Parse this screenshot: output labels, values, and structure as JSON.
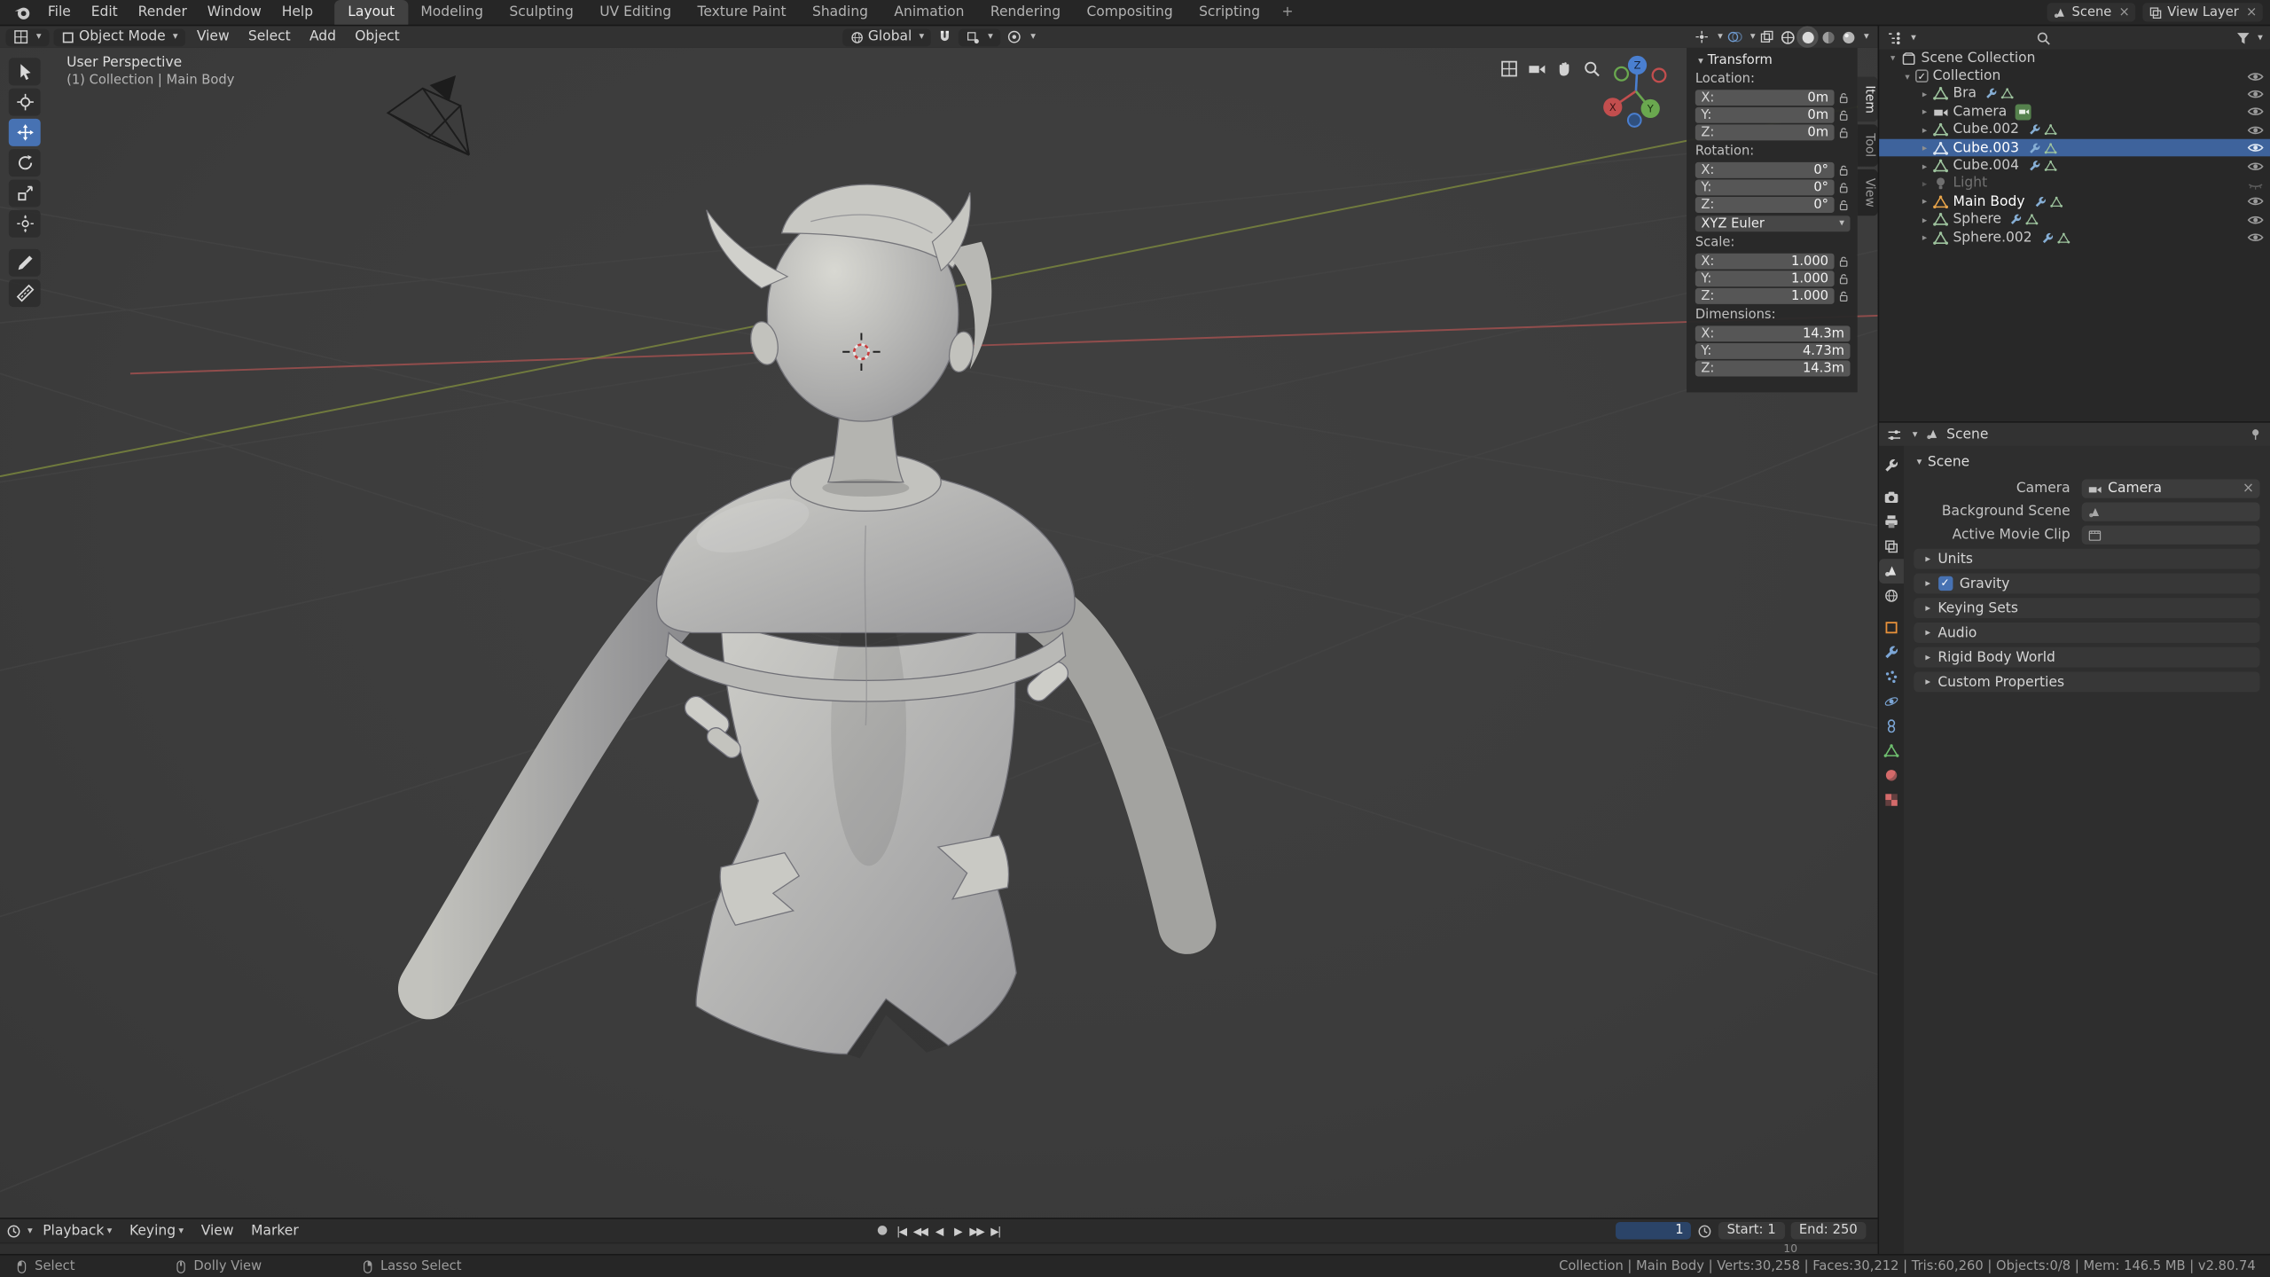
{
  "colors": {
    "accent": "#4772b3",
    "selection_row": "#3e639c",
    "active_object_icon": "#e8a44a",
    "axis_x": "#a0504f",
    "axis_y": "#7d8a3e",
    "gizmo_z": "#4a7fd0",
    "viewport_background": "#3d3d3d"
  },
  "icons": {
    "chevron": "▾",
    "expand": "▸",
    "close": "×",
    "check": "✓",
    "record": "●",
    "jump_start": "|◀",
    "prev_key": "◀◀",
    "play_rev": "◀",
    "play": "▶",
    "next_key": "▶▶",
    "jump_end": "▶|"
  },
  "topbar": {
    "menus": [
      {
        "label": "File"
      },
      {
        "label": "Edit"
      },
      {
        "label": "Render"
      },
      {
        "label": "Window"
      },
      {
        "label": "Help"
      }
    ],
    "workspaces": [
      {
        "label": "Layout",
        "active": true
      },
      {
        "label": "Modeling"
      },
      {
        "label": "Sculpting"
      },
      {
        "label": "UV Editing"
      },
      {
        "label": "Texture Paint"
      },
      {
        "label": "Shading"
      },
      {
        "label": "Animation"
      },
      {
        "label": "Rendering"
      },
      {
        "label": "Compositing"
      },
      {
        "label": "Scripting"
      }
    ],
    "new_workspace": "+",
    "scene_selector": "Scene",
    "view_layer_selector": "View Layer"
  },
  "viewport": {
    "mode": "Object Mode",
    "menus": [
      {
        "label": "View"
      },
      {
        "label": "Select"
      },
      {
        "label": "Add"
      },
      {
        "label": "Object"
      }
    ],
    "orientation": "Global",
    "view_label": "User Perspective",
    "context_label": "(1) Collection | Main Body",
    "gizmo": {
      "x": "X",
      "y": "Y",
      "z": "Z"
    }
  },
  "npanel": {
    "tabs": [
      {
        "label": "Item",
        "active": true
      },
      {
        "label": "Tool"
      },
      {
        "label": "View"
      }
    ],
    "transform": {
      "title": "Transform",
      "location_label": "Location:",
      "rotation_label": "Rotation:",
      "scale_label": "Scale:",
      "dimensions_label": "Dimensions:",
      "rotation_mode": "XYZ Euler",
      "rows": {
        "loc_x": {
          "label": "X:",
          "value": "0m"
        },
        "loc_y": {
          "label": "Y:",
          "value": "0m"
        },
        "loc_z": {
          "label": "Z:",
          "value": "0m"
        },
        "rot_x": {
          "label": "X:",
          "value": "0°"
        },
        "rot_y": {
          "label": "Y:",
          "value": "0°"
        },
        "rot_z": {
          "label": "Z:",
          "value": "0°"
        },
        "scale_x": {
          "label": "X:",
          "value": "1.000"
        },
        "scale_y": {
          "label": "Y:",
          "value": "1.000"
        },
        "scale_z": {
          "label": "Z:",
          "value": "1.000"
        },
        "dim_x": {
          "label": "X:",
          "value": "14.3m"
        },
        "dim_y": {
          "label": "Y:",
          "value": "4.73m"
        },
        "dim_z": {
          "label": "Z:",
          "value": "14.3m"
        }
      }
    }
  },
  "outliner": {
    "scene_collection": "Scene Collection",
    "collection": "Collection",
    "items": [
      {
        "name": "Bra",
        "type": "mesh"
      },
      {
        "name": "Camera",
        "type": "camera"
      },
      {
        "name": "Cube.002",
        "type": "mesh"
      },
      {
        "name": "Cube.003",
        "type": "mesh",
        "selected": true
      },
      {
        "name": "Cube.004",
        "type": "mesh"
      },
      {
        "name": "Light",
        "type": "light",
        "hidden": true
      },
      {
        "name": "Main Body",
        "type": "mesh",
        "active": true
      },
      {
        "name": "Sphere",
        "type": "mesh"
      },
      {
        "name": "Sphere.002",
        "type": "mesh"
      }
    ]
  },
  "properties": {
    "breadcrumb": "Scene",
    "panel_title": "Scene",
    "camera_label": "Camera",
    "camera_value": "Camera",
    "background_scene_label": "Background Scene",
    "active_movie_clip_label": "Active Movie Clip",
    "sections": [
      {
        "label": "Units"
      },
      {
        "label": "Gravity",
        "checkbox": true
      },
      {
        "label": "Keying Sets"
      },
      {
        "label": "Audio"
      },
      {
        "label": "Rigid Body World"
      },
      {
        "label": "Custom Properties"
      }
    ]
  },
  "timeline": {
    "menus": [
      {
        "label": "Playback"
      },
      {
        "label": "Keying"
      },
      {
        "label": "View"
      },
      {
        "label": "Marker"
      }
    ],
    "current_frame": "1",
    "start_label": "Start:",
    "start_value": "1",
    "end_label": "End:",
    "end_value": "250",
    "ruler_mark": "10"
  },
  "statusbar": {
    "hints": [
      {
        "label": "Select"
      },
      {
        "label": "Dolly View"
      },
      {
        "label": "Lasso Select"
      }
    ],
    "stats": "Collection | Main Body | Verts:30,258 | Faces:30,212 | Tris:60,260 | Objects:0/8 | Mem: 146.5 MB | v2.80.74"
  }
}
